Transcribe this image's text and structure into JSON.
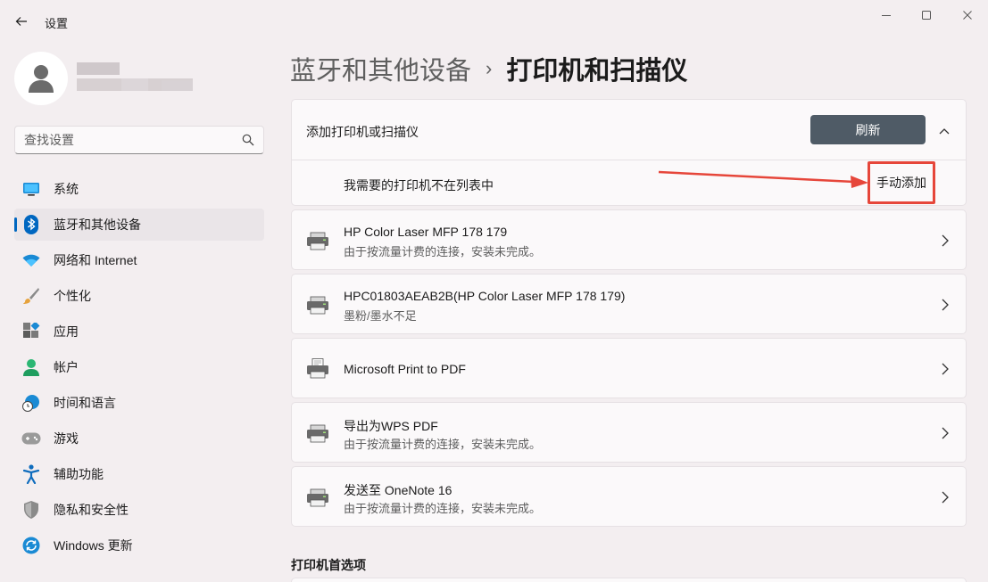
{
  "window": {
    "title": "设置"
  },
  "search": {
    "placeholder": "查找设置"
  },
  "sidebar": {
    "items": [
      {
        "label": "系统",
        "icon": "monitor-icon"
      },
      {
        "label": "蓝牙和其他设备",
        "icon": "bluetooth-icon",
        "active": true
      },
      {
        "label": "网络和 Internet",
        "icon": "wifi-icon"
      },
      {
        "label": "个性化",
        "icon": "brush-icon"
      },
      {
        "label": "应用",
        "icon": "apps-icon"
      },
      {
        "label": "帐户",
        "icon": "account-icon"
      },
      {
        "label": "时间和语言",
        "icon": "globe-clock-icon"
      },
      {
        "label": "游戏",
        "icon": "gamepad-icon"
      },
      {
        "label": "辅助功能",
        "icon": "accessibility-icon"
      },
      {
        "label": "隐私和安全性",
        "icon": "shield-icon"
      },
      {
        "label": "Windows 更新",
        "icon": "update-icon"
      }
    ]
  },
  "breadcrumb": {
    "parent": "蓝牙和其他设备",
    "separator": "›",
    "current": "打印机和扫描仪"
  },
  "add_panel": {
    "title": "添加打印机或扫描仪",
    "refresh_label": "刷新",
    "manual_text": "我需要的打印机不在列表中",
    "manual_button": "手动添加"
  },
  "printers": [
    {
      "name": "HP Color Laser MFP 178 179",
      "status": "由于按流量计费的连接，安装未完成。"
    },
    {
      "name": "HPC01803AEAB2B(HP Color Laser MFP 178 179)",
      "status": "墨粉/墨水不足"
    },
    {
      "name": "Microsoft Print to PDF",
      "status": ""
    },
    {
      "name": "导出为WPS PDF",
      "status": "由于按流量计费的连接，安装未完成。"
    },
    {
      "name": "发送至 OneNote 16",
      "status": "由于按流量计费的连接，安装未完成。"
    }
  ],
  "preferences": {
    "title": "打印机首选项"
  },
  "colors": {
    "accent": "#0067c0",
    "refresh_button": "#4f5b66",
    "highlight": "#e6463a"
  }
}
